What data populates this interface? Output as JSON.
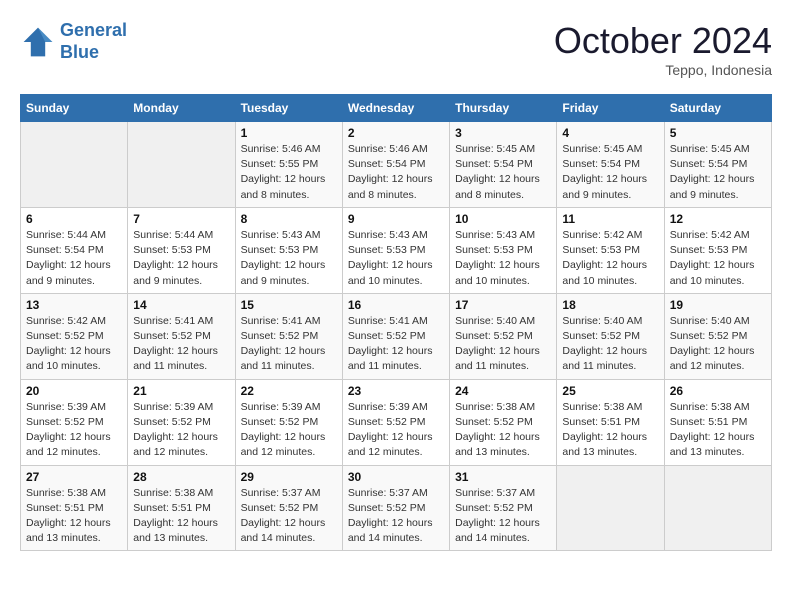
{
  "logo": {
    "line1": "General",
    "line2": "Blue"
  },
  "header": {
    "month": "October 2024",
    "location": "Teppo, Indonesia"
  },
  "weekdays": [
    "Sunday",
    "Monday",
    "Tuesday",
    "Wednesday",
    "Thursday",
    "Friday",
    "Saturday"
  ],
  "weeks": [
    [
      {
        "day": "",
        "empty": true
      },
      {
        "day": "",
        "empty": true
      },
      {
        "day": "1",
        "sunrise": "Sunrise: 5:46 AM",
        "sunset": "Sunset: 5:55 PM",
        "daylight": "Daylight: 12 hours and 8 minutes."
      },
      {
        "day": "2",
        "sunrise": "Sunrise: 5:46 AM",
        "sunset": "Sunset: 5:54 PM",
        "daylight": "Daylight: 12 hours and 8 minutes."
      },
      {
        "day": "3",
        "sunrise": "Sunrise: 5:45 AM",
        "sunset": "Sunset: 5:54 PM",
        "daylight": "Daylight: 12 hours and 8 minutes."
      },
      {
        "day": "4",
        "sunrise": "Sunrise: 5:45 AM",
        "sunset": "Sunset: 5:54 PM",
        "daylight": "Daylight: 12 hours and 9 minutes."
      },
      {
        "day": "5",
        "sunrise": "Sunrise: 5:45 AM",
        "sunset": "Sunset: 5:54 PM",
        "daylight": "Daylight: 12 hours and 9 minutes."
      }
    ],
    [
      {
        "day": "6",
        "sunrise": "Sunrise: 5:44 AM",
        "sunset": "Sunset: 5:54 PM",
        "daylight": "Daylight: 12 hours and 9 minutes."
      },
      {
        "day": "7",
        "sunrise": "Sunrise: 5:44 AM",
        "sunset": "Sunset: 5:53 PM",
        "daylight": "Daylight: 12 hours and 9 minutes."
      },
      {
        "day": "8",
        "sunrise": "Sunrise: 5:43 AM",
        "sunset": "Sunset: 5:53 PM",
        "daylight": "Daylight: 12 hours and 9 minutes."
      },
      {
        "day": "9",
        "sunrise": "Sunrise: 5:43 AM",
        "sunset": "Sunset: 5:53 PM",
        "daylight": "Daylight: 12 hours and 10 minutes."
      },
      {
        "day": "10",
        "sunrise": "Sunrise: 5:43 AM",
        "sunset": "Sunset: 5:53 PM",
        "daylight": "Daylight: 12 hours and 10 minutes."
      },
      {
        "day": "11",
        "sunrise": "Sunrise: 5:42 AM",
        "sunset": "Sunset: 5:53 PM",
        "daylight": "Daylight: 12 hours and 10 minutes."
      },
      {
        "day": "12",
        "sunrise": "Sunrise: 5:42 AM",
        "sunset": "Sunset: 5:53 PM",
        "daylight": "Daylight: 12 hours and 10 minutes."
      }
    ],
    [
      {
        "day": "13",
        "sunrise": "Sunrise: 5:42 AM",
        "sunset": "Sunset: 5:52 PM",
        "daylight": "Daylight: 12 hours and 10 minutes."
      },
      {
        "day": "14",
        "sunrise": "Sunrise: 5:41 AM",
        "sunset": "Sunset: 5:52 PM",
        "daylight": "Daylight: 12 hours and 11 minutes."
      },
      {
        "day": "15",
        "sunrise": "Sunrise: 5:41 AM",
        "sunset": "Sunset: 5:52 PM",
        "daylight": "Daylight: 12 hours and 11 minutes."
      },
      {
        "day": "16",
        "sunrise": "Sunrise: 5:41 AM",
        "sunset": "Sunset: 5:52 PM",
        "daylight": "Daylight: 12 hours and 11 minutes."
      },
      {
        "day": "17",
        "sunrise": "Sunrise: 5:40 AM",
        "sunset": "Sunset: 5:52 PM",
        "daylight": "Daylight: 12 hours and 11 minutes."
      },
      {
        "day": "18",
        "sunrise": "Sunrise: 5:40 AM",
        "sunset": "Sunset: 5:52 PM",
        "daylight": "Daylight: 12 hours and 11 minutes."
      },
      {
        "day": "19",
        "sunrise": "Sunrise: 5:40 AM",
        "sunset": "Sunset: 5:52 PM",
        "daylight": "Daylight: 12 hours and 12 minutes."
      }
    ],
    [
      {
        "day": "20",
        "sunrise": "Sunrise: 5:39 AM",
        "sunset": "Sunset: 5:52 PM",
        "daylight": "Daylight: 12 hours and 12 minutes."
      },
      {
        "day": "21",
        "sunrise": "Sunrise: 5:39 AM",
        "sunset": "Sunset: 5:52 PM",
        "daylight": "Daylight: 12 hours and 12 minutes."
      },
      {
        "day": "22",
        "sunrise": "Sunrise: 5:39 AM",
        "sunset": "Sunset: 5:52 PM",
        "daylight": "Daylight: 12 hours and 12 minutes."
      },
      {
        "day": "23",
        "sunrise": "Sunrise: 5:39 AM",
        "sunset": "Sunset: 5:52 PM",
        "daylight": "Daylight: 12 hours and 12 minutes."
      },
      {
        "day": "24",
        "sunrise": "Sunrise: 5:38 AM",
        "sunset": "Sunset: 5:52 PM",
        "daylight": "Daylight: 12 hours and 13 minutes."
      },
      {
        "day": "25",
        "sunrise": "Sunrise: 5:38 AM",
        "sunset": "Sunset: 5:51 PM",
        "daylight": "Daylight: 12 hours and 13 minutes."
      },
      {
        "day": "26",
        "sunrise": "Sunrise: 5:38 AM",
        "sunset": "Sunset: 5:51 PM",
        "daylight": "Daylight: 12 hours and 13 minutes."
      }
    ],
    [
      {
        "day": "27",
        "sunrise": "Sunrise: 5:38 AM",
        "sunset": "Sunset: 5:51 PM",
        "daylight": "Daylight: 12 hours and 13 minutes."
      },
      {
        "day": "28",
        "sunrise": "Sunrise: 5:38 AM",
        "sunset": "Sunset: 5:51 PM",
        "daylight": "Daylight: 12 hours and 13 minutes."
      },
      {
        "day": "29",
        "sunrise": "Sunrise: 5:37 AM",
        "sunset": "Sunset: 5:52 PM",
        "daylight": "Daylight: 12 hours and 14 minutes."
      },
      {
        "day": "30",
        "sunrise": "Sunrise: 5:37 AM",
        "sunset": "Sunset: 5:52 PM",
        "daylight": "Daylight: 12 hours and 14 minutes."
      },
      {
        "day": "31",
        "sunrise": "Sunrise: 5:37 AM",
        "sunset": "Sunset: 5:52 PM",
        "daylight": "Daylight: 12 hours and 14 minutes."
      },
      {
        "day": "",
        "empty": true
      },
      {
        "day": "",
        "empty": true
      }
    ]
  ]
}
